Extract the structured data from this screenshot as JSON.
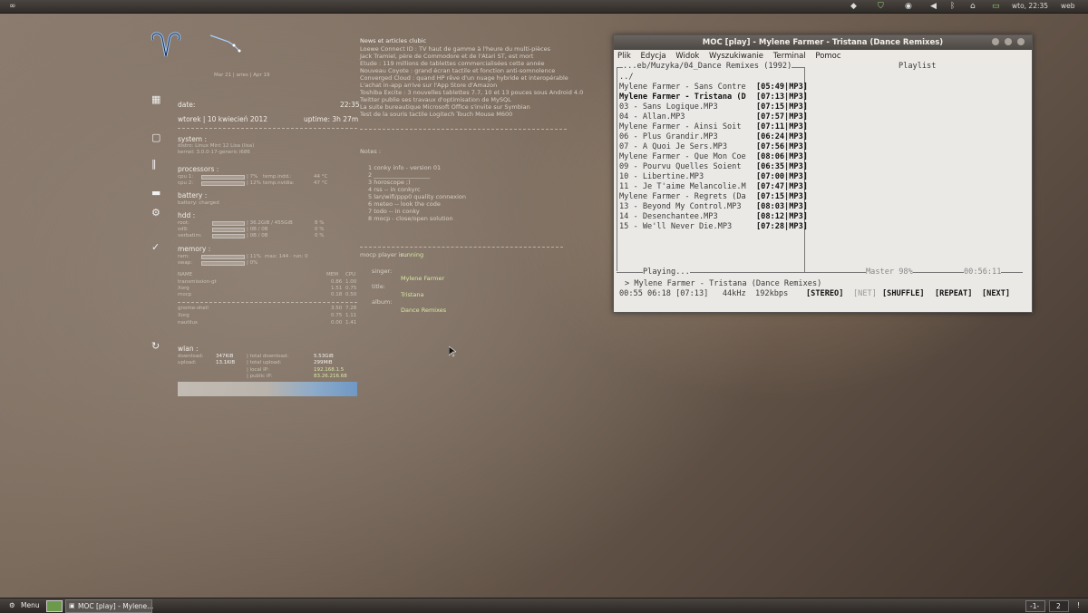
{
  "top_panel": {
    "clock": "wto, 22:35",
    "web_label": "web"
  },
  "conky": {
    "moon_line": "Mar 21 | aries | Apr 19",
    "date_label": "date:",
    "time": "22:35",
    "date_value": "wtorek | 10 kwiecień 2012",
    "uptime": "uptime: 3h 27m",
    "system_label": "system :",
    "distro": "distro: Linux Mint 12 Lisa (lisa)",
    "kernel": "kernel: 3.0.0-17-generic i686",
    "processors_label": "processors :",
    "cpu1": "cpu 1:",
    "cpu1_pct": "| 7%",
    "cpu1_temp_label": "temp.indd.:",
    "cpu1_temp": "44 °C",
    "cpu2": "cpu 2:",
    "cpu2_pct": "| 12%",
    "cpu2_temp_label": "temp.nvidia:",
    "cpu2_temp": "47 °C",
    "battery_label": "battery :",
    "battery_state": "battery: charged",
    "hdd_label": "hdd :",
    "hdd_rows": [
      {
        "name": "root:",
        "vals": "| 36.2GiB / 455GiB",
        "pct": "8 %"
      },
      {
        "name": "sd9:",
        "vals": "| 0B  / 0B",
        "pct": "0 %"
      },
      {
        "name": "verbatim:",
        "vals": "| 0B  / 0B",
        "pct": "0 %"
      }
    ],
    "memory_label": "memory :",
    "ram": "ram:",
    "ram_vals": "| 11%",
    "ram_extra": "max: 144 · run: 0",
    "swap": "swap:",
    "swap_vals": "| 0%",
    "proc_headers": [
      "NAME",
      "MEM",
      "CPU"
    ],
    "procs": [
      {
        "name": "transmission-gt",
        "mem": "0.86",
        "cpu": "1.00"
      },
      {
        "name": "Xorg",
        "mem": "1.51",
        "cpu": "0.75"
      },
      {
        "name": "mocp",
        "mem": "0.18",
        "cpu": "0.50"
      }
    ],
    "procs2": [
      {
        "name": "gnome-shell",
        "mem": "3.50",
        "cpu": "7.28"
      },
      {
        "name": "Xorg",
        "mem": "0.75",
        "cpu": "1.11"
      },
      {
        "name": "nautilus",
        "mem": "0.00",
        "cpu": "1.41"
      }
    ],
    "wlan_label": "wlan :",
    "download": "download:",
    "download_val": "347KiB",
    "total_down": "| total download:",
    "total_down_val": "5.53GiB",
    "upload": "upload:",
    "upload_val": "13.1KiB",
    "total_up": "| total upload:",
    "total_up_val": "299MiB",
    "local_ip": "| local IP:",
    "local_ip_val": "192.168.1.5",
    "public_ip": "| public IP:",
    "public_ip_val": "83.26.216.68"
  },
  "news": {
    "title": "News et articles clubic",
    "items": [
      "Loewe Connect ID : TV haut de gamme à l'heure du multi-pièces",
      "Jack Tramiel, père de Commodore et de l'Atari ST, est mort",
      "Etude : 119 millions de tablettes commercialisées cette année",
      "Nouveau Coyote : grand écran tactile et fonction anti-somnolence",
      "Converged Cloud : quand HP rêve d'un nuage hybride et interopérable",
      "L'achat in-app arrive sur l'App Store d'Amazon",
      "Toshiba Excite : 3 nouvelles tablettes 7.7, 10 et 13 pouces sous Android 4.0",
      "Twitter publie ses travaux d'optimisation de MySQL",
      "La suite bureautique Microsoft Office s'invite sur Symbian",
      "Test de la souris tactile Logitech Touch Mouse M600"
    ],
    "notes_label": "Notes :",
    "notes": [
      "1 conky info - version 01",
      "2 ___________________",
      "3 horoscope ;)",
      "4 rss -- in conkyrc",
      "5 lan/wifi/ppp0 quality connexion",
      "6 meteo -- look the code",
      "7 todo -- in conky",
      "8 mocp - close/open solution"
    ],
    "mocp_status_label": "mocp player is :",
    "mocp_status": "running",
    "singer_label": "singer:",
    "singer": "Mylene Farmer",
    "title_label": "title:",
    "title_val": "Tristana",
    "album_label": "album:",
    "album": "Dance Remixes"
  },
  "terminal": {
    "title": "MOC [play] - Mylene Farmer - Tristana (Dance Remixes)",
    "menu": [
      "Plik",
      "Edycja",
      "Widok",
      "Wyszukiwanie",
      "Terminal",
      "Pomoc"
    ],
    "path": "...eb/Muzyka/04_Dance Remixes (1992)",
    "playlist_label": "Playlist",
    "parent": "../",
    "tracks": [
      {
        "name": "Mylene Farmer - Sans Contre",
        "time": "[05:49|MP3]",
        "bold": false
      },
      {
        "name": "Mylene Farmer - Tristana (D",
        "time": "[07:13|MP3]",
        "bold": true
      },
      {
        "name": "03 - Sans Logique.MP3",
        "time": "[07:15|MP3]",
        "bold": false
      },
      {
        "name": "04 - Allan.MP3",
        "time": "[07:57|MP3]",
        "bold": false
      },
      {
        "name": "Mylene Farmer - Ainsi Soit",
        "time": "[07:11|MP3]",
        "bold": false
      },
      {
        "name": "06 - Plus Grandir.MP3",
        "time": "[06:24|MP3]",
        "bold": false
      },
      {
        "name": "07 - A Quoi Je Sers.MP3",
        "time": "[07:56|MP3]",
        "bold": false
      },
      {
        "name": "Mylene Farmer - Que Mon Coe",
        "time": "[08:06|MP3]",
        "bold": false
      },
      {
        "name": "09 - Pourvu Quelles Soient",
        "time": "[06:35|MP3]",
        "bold": false
      },
      {
        "name": "10 - Libertine.MP3",
        "time": "[07:00|MP3]",
        "bold": false
      },
      {
        "name": "11 - Je T'aime Melancolie.M",
        "time": "[07:47|MP3]",
        "bold": false
      },
      {
        "name": "Mylene Farmer - Regrets (Da",
        "time": "[07:15|MP3]",
        "bold": false
      },
      {
        "name": "13 - Beyond My Control.MP3",
        "time": "[08:03|MP3]",
        "bold": false
      },
      {
        "name": "14 - Desenchantee.MP3",
        "time": "[08:12|MP3]",
        "bold": false
      },
      {
        "name": "15 - We'll Never Die.MP3",
        "time": "[07:28|MP3]",
        "bold": false
      }
    ],
    "playing_label": "Playing...",
    "master": "Master 98%",
    "total_time": "00:56:11",
    "now_playing": "> Mylene Farmer - Tristana (Dance Remixes)",
    "status_line": "00:55 06:18 [07:13]   44kHz  192kbps",
    "flags": [
      "[STEREO]",
      "[NET]",
      "[SHUFFLE]",
      "[REPEAT]",
      "[NEXT]"
    ]
  },
  "bottom_panel": {
    "menu_label": "Menu",
    "task_label": "MOC [play] - Mylene...",
    "ws1": "-1-",
    "ws2": "2",
    "tray": "!"
  }
}
